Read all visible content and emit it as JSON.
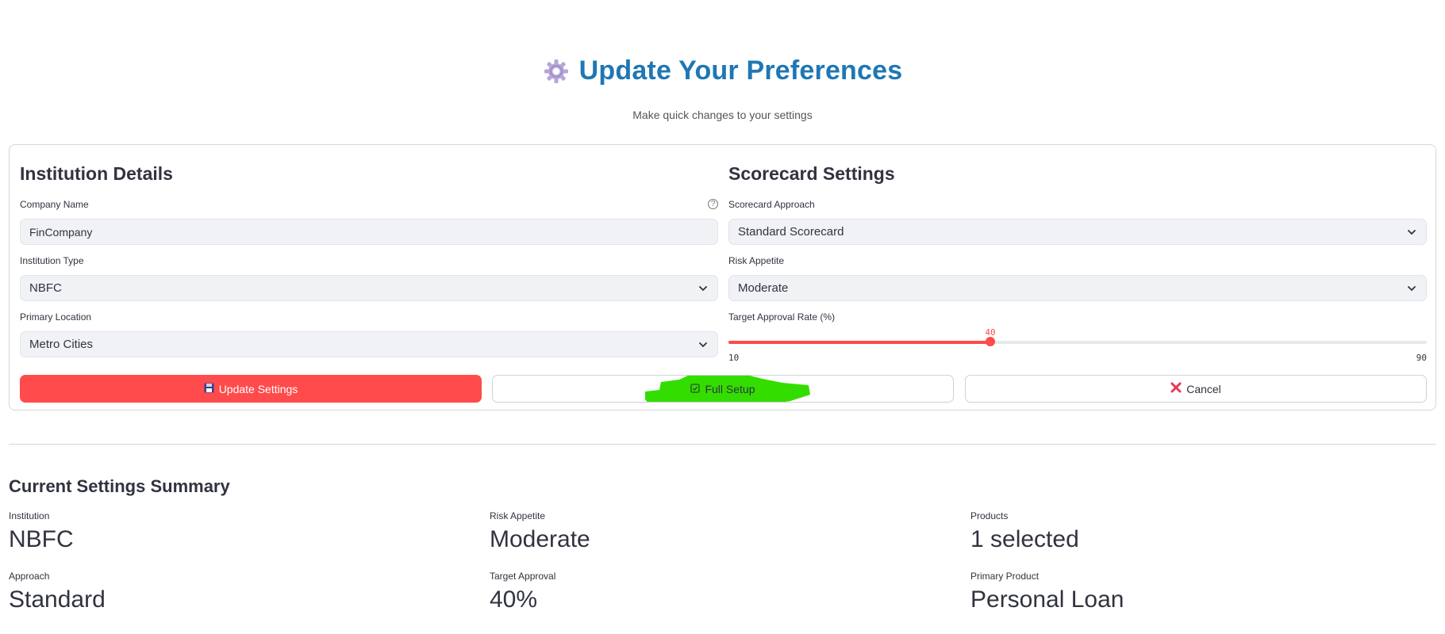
{
  "header": {
    "icon": "gear-icon",
    "title": "Update Your Preferences",
    "subtitle": "Make quick changes to your settings"
  },
  "institution": {
    "section_title": "Institution Details",
    "company_name_label": "Company Name",
    "company_name_value": "FinCompany",
    "institution_type_label": "Institution Type",
    "institution_type_value": "NBFC",
    "primary_location_label": "Primary Location",
    "primary_location_value": "Metro Cities"
  },
  "scorecard": {
    "section_title": "Scorecard Settings",
    "approach_label": "Scorecard Approach",
    "approach_value": "Standard Scorecard",
    "risk_label": "Risk Appetite",
    "risk_value": "Moderate",
    "approval_label": "Target Approval Rate (%)",
    "approval_value": 40,
    "approval_min": 10,
    "approval_max": 90
  },
  "buttons": {
    "update_label": "Update Settings",
    "update_icon": "floppy-disk-icon",
    "full_setup_label": "Full Setup",
    "full_setup_icon": "clipboard-icon",
    "cancel_label": "Cancel",
    "cancel_icon": "close-x-icon"
  },
  "summary": {
    "title": "Current Settings Summary",
    "metrics": [
      {
        "label": "Institution",
        "value": "NBFC"
      },
      {
        "label": "Risk Appetite",
        "value": "Moderate"
      },
      {
        "label": "Products",
        "value": "1 selected"
      },
      {
        "label": "Approach",
        "value": "Standard"
      },
      {
        "label": "Target Approval",
        "value": "40%"
      },
      {
        "label": "Primary Product",
        "value": "Personal Loan"
      }
    ]
  },
  "colors": {
    "title": "#1f77b4",
    "accent": "#ff4b4b",
    "scribble": "#33dd00"
  }
}
